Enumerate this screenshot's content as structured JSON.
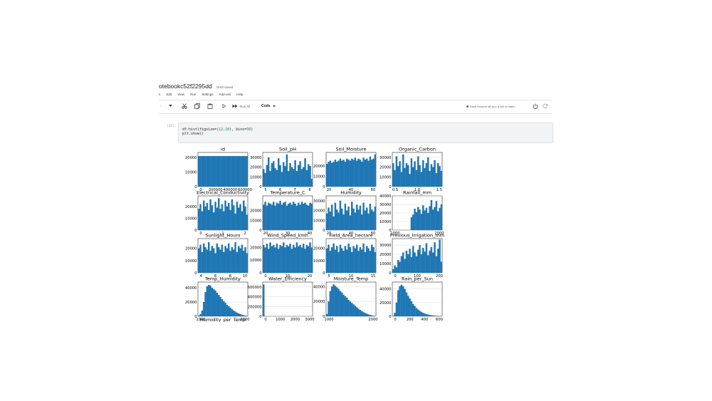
{
  "notebook": {
    "title": "otebookc52f2295dd",
    "status": "Draft saved"
  },
  "menu": [
    "e",
    "Edit",
    "View",
    "Run",
    "Settings",
    "Add-ons",
    "Help"
  ],
  "toolbar": {
    "run_all_label": "Run All",
    "cell_type_label": "Code",
    "session_status": "Draft Session off (run a cell to start)"
  },
  "cell": {
    "prompt": "[32]:",
    "code_line1_prefix": "df.hist(figsize=(",
    "code_line1_nums": "12,10",
    "code_line1_mid": "), bins=",
    "code_line1_bins": "30",
    "code_line1_suffix": ")",
    "code_line2": "plt.show()"
  },
  "colors": {
    "bar": "#1f77b4",
    "cell_bg": "#f1f3f4"
  },
  "chart_data": [
    {
      "type": "bar",
      "title": "id",
      "yticks": [
        0,
        10000,
        20000
      ],
      "xticks": [
        "0",
        "200000",
        "400000",
        "600000"
      ],
      "values": [
        21000,
        21000,
        21000,
        21000,
        21000,
        21000,
        21000,
        21000,
        21000,
        21000,
        21000,
        21000,
        21000,
        21000,
        21000,
        21000,
        21000,
        21000,
        21000,
        21000,
        21000,
        21000,
        21000,
        21000,
        21000,
        21000,
        21000,
        21000,
        21000,
        21000
      ],
      "ylim": [
        0,
        23500
      ]
    },
    {
      "type": "bar",
      "title": "Soil_pH",
      "yticks": [
        0,
        10000,
        20000,
        30000
      ],
      "xticks": [
        "5",
        "6",
        "7",
        "8"
      ],
      "values": [
        18000,
        14000,
        22000,
        30000,
        16000,
        24000,
        26000,
        19000,
        17000,
        29000,
        22000,
        15000,
        25000,
        21000,
        33000,
        16000,
        24000,
        20000,
        18000,
        27000,
        16000,
        22000,
        26000,
        18000,
        20000,
        29000,
        17000,
        23000,
        21000,
        8000
      ],
      "ylim": [
        0,
        35000
      ]
    },
    {
      "type": "bar",
      "title": "Soil_Moisture",
      "yticks": [
        0,
        10000,
        20000
      ],
      "xticks": [
        "20",
        "40",
        "60"
      ],
      "values": [
        22000,
        24000,
        25000,
        23000,
        24000,
        26000,
        24000,
        25000,
        27000,
        25000,
        26000,
        24000,
        27000,
        26000,
        25000,
        27000,
        26000,
        28000,
        25000,
        27000,
        26000,
        24000,
        28000,
        26000,
        27000,
        25000,
        29000,
        26000,
        27000,
        31000
      ],
      "ylim": [
        0,
        33000
      ]
    },
    {
      "type": "bar",
      "title": "Organic_Carbon",
      "yticks": [
        0,
        10000,
        20000,
        30000
      ],
      "xticks": [
        "0.5",
        "1.0",
        "1.5"
      ],
      "values": [
        24000,
        17000,
        31000,
        21000,
        26000,
        15000,
        33000,
        19000,
        24000,
        22000,
        13000,
        29000,
        20000,
        26000,
        17000,
        31000,
        22000,
        15000,
        27000,
        19000,
        24000,
        30000,
        16000,
        23000,
        20000,
        27000,
        14000,
        24000,
        21000,
        16000
      ],
      "ylim": [
        0,
        35000
      ]
    },
    {
      "type": "bar",
      "title": "Electrical_Conductivity",
      "yticks": [
        0,
        10000,
        20000
      ],
      "xticks": [
        "0",
        "1",
        "2"
      ],
      "values": [
        18000,
        22000,
        16000,
        25000,
        20000,
        23000,
        17000,
        26000,
        21000,
        15000,
        24000,
        19000,
        27000,
        18000,
        22000,
        16000,
        25000,
        20000,
        23000,
        17000,
        26000,
        21000,
        14000,
        24000,
        19000,
        22000,
        16000,
        25000,
        20000,
        13000
      ],
      "ylim": [
        0,
        29000
      ]
    },
    {
      "type": "bar",
      "title": "Temperature_C",
      "yticks": [
        0,
        10000,
        20000
      ],
      "xticks": [
        "20",
        "30",
        "40"
      ],
      "values": [
        26000,
        29000,
        25000,
        28000,
        27000,
        26000,
        29000,
        25000,
        28000,
        27000,
        30000,
        26000,
        28000,
        29000,
        25000,
        27000,
        28000,
        26000,
        29000,
        27000,
        25000,
        28000,
        26000,
        29000,
        27000,
        28000,
        26000,
        25000,
        28000,
        27000
      ],
      "ylim": [
        0,
        35000
      ]
    },
    {
      "type": "bar",
      "title": "Humidity",
      "yticks": [
        0,
        10000,
        20000,
        30000
      ],
      "xticks": [
        "20",
        "40",
        "60"
      ],
      "values": [
        17000,
        23000,
        19000,
        26000,
        14000,
        28000,
        21000,
        18000,
        30000,
        22000,
        16000,
        27000,
        20000,
        24000,
        15000,
        29000,
        22000,
        18000,
        26000,
        21000,
        25000,
        16000,
        28000,
        20000,
        23000,
        17000,
        27000,
        21000,
        19000,
        24000
      ],
      "ylim": [
        0,
        35000
      ]
    },
    {
      "type": "bar",
      "title": "Rainfall_mm",
      "yticks": [
        0,
        10000,
        20000,
        30000,
        40000
      ],
      "xticks": [
        "1000",
        "2000"
      ],
      "values": [
        0,
        0,
        0,
        0,
        0,
        0,
        0,
        0,
        0,
        0,
        0,
        15000,
        18000,
        25000,
        21000,
        27000,
        24000,
        19000,
        29000,
        23000,
        26000,
        20000,
        28000,
        35000,
        24000,
        27000,
        34000,
        22000,
        26000,
        30000
      ],
      "ylim": [
        0,
        40000
      ]
    },
    {
      "type": "bar",
      "title": "Sunlight_Hours",
      "yticks": [
        0,
        10000,
        20000
      ],
      "xticks": [
        "4",
        "6",
        "8",
        "10"
      ],
      "values": [
        20000,
        23000,
        17000,
        24000,
        21000,
        19000,
        25000,
        18000,
        22000,
        20000,
        16000,
        24000,
        21000,
        19000,
        23000,
        17000,
        22000,
        20000,
        24000,
        18000,
        21000,
        19000,
        25000,
        17000,
        22000,
        20000,
        23000,
        18000,
        21000,
        16000
      ],
      "ylim": [
        0,
        28000
      ]
    },
    {
      "type": "bar",
      "title": "Wind_Speed_kmh",
      "yticks": [
        0,
        10000,
        20000
      ],
      "xticks": [
        "0",
        "10",
        "20"
      ],
      "values": [
        22000,
        20000,
        23000,
        19000,
        24000,
        21000,
        22000,
        20000,
        23000,
        19000,
        22000,
        21000,
        24000,
        20000,
        22000,
        21000,
        23000,
        19000,
        22000,
        20000,
        24000,
        21000,
        22000,
        20000,
        23000,
        19000,
        22000,
        21000,
        24000,
        20000
      ],
      "ylim": [
        0,
        27000
      ]
    },
    {
      "type": "bar",
      "title": "Field_Area_hectare",
      "yticks": [
        0,
        10000,
        20000
      ],
      "xticks": [
        "5",
        "10",
        "15"
      ],
      "values": [
        20000,
        23000,
        18000,
        21000,
        24000,
        19000,
        22000,
        17000,
        23000,
        20000,
        18000,
        22000,
        19000,
        24000,
        21000,
        17000,
        22000,
        20000,
        23000,
        18000,
        21000,
        19000,
        24000,
        17000,
        22000,
        20000,
        18000,
        23000,
        21000,
        17000
      ],
      "ylim": [
        0,
        28000
      ]
    },
    {
      "type": "bar",
      "title": "Previous_Irrigation_mm",
      "yticks": [
        0,
        10000,
        20000,
        30000
      ],
      "xticks": [
        "0",
        "100",
        "200"
      ],
      "values": [
        4000,
        8000,
        6000,
        14000,
        12000,
        18000,
        22000,
        15000,
        24000,
        20000,
        26000,
        17000,
        29000,
        22000,
        18000,
        25000,
        30000,
        20000,
        27000,
        23000,
        32000,
        19000,
        24000,
        28000,
        22000,
        33000,
        18000,
        26000,
        36000,
        12000
      ],
      "ylim": [
        0,
        37000
      ]
    },
    {
      "type": "bar",
      "title": "Temp_Humidity",
      "yticks": [
        0,
        20000,
        40000
      ],
      "xticks": [
        "1000",
        "2000"
      ],
      "values": [
        1000,
        3000,
        8000,
        20000,
        34000,
        42000,
        44000,
        43000,
        40000,
        38000,
        36000,
        33000,
        30000,
        27000,
        24000,
        21000,
        19000,
        16000,
        14000,
        12000,
        10000,
        8000,
        6500,
        5000,
        4000,
        3000,
        2200,
        1500,
        1000,
        500
      ],
      "ylim": [
        0,
        48000
      ],
      "xmax": 2600
    },
    {
      "type": "bar",
      "title": "Water_Efficiency",
      "yticks": [
        0,
        200000,
        400000,
        600000
      ],
      "xticks": [
        "0",
        "1000",
        "2000",
        "3000"
      ],
      "values": [
        650000,
        5000,
        1000,
        500,
        200,
        100,
        50,
        20,
        10,
        5,
        3,
        2,
        1,
        1,
        1,
        0,
        0,
        0,
        0,
        0,
        0,
        0,
        0,
        0,
        0,
        0,
        0,
        0,
        0,
        0
      ],
      "ylim": [
        0,
        700000
      ],
      "xmax": 3300
    },
    {
      "type": "bar",
      "title": "Moisture_Temp",
      "yticks": [
        0,
        20000,
        40000
      ],
      "xticks": [
        "1000",
        "2000"
      ],
      "values": [
        3000,
        20000,
        34000,
        40000,
        43000,
        41000,
        39000,
        37000,
        34000,
        32000,
        29000,
        27000,
        25000,
        22000,
        20000,
        18000,
        16000,
        14000,
        12000,
        10000,
        8500,
        7000,
        5500,
        4500,
        3500,
        2500,
        1800,
        1200,
        700,
        400
      ],
      "ylim": [
        0,
        46000
      ],
      "xmax": 2600
    },
    {
      "type": "bar",
      "title": "Rain_per_Sun",
      "yticks": [
        0,
        20000,
        40000
      ],
      "xticks": [
        "0",
        "200",
        "400",
        "600"
      ],
      "values": [
        500,
        5000,
        20000,
        38000,
        44000,
        46000,
        44000,
        40000,
        35000,
        30000,
        26000,
        22000,
        18000,
        15000,
        12000,
        10000,
        8000,
        6500,
        5000,
        4000,
        3000,
        2500,
        2000,
        1500,
        1200,
        900,
        700,
        500,
        300,
        200
      ],
      "ylim": [
        0,
        50000
      ],
      "xmax": 650
    },
    {
      "type": "bar",
      "title": "Humidity_per_Temp",
      "yticks": [],
      "xticks": [],
      "values": [],
      "ylim": [
        0,
        1
      ]
    }
  ]
}
